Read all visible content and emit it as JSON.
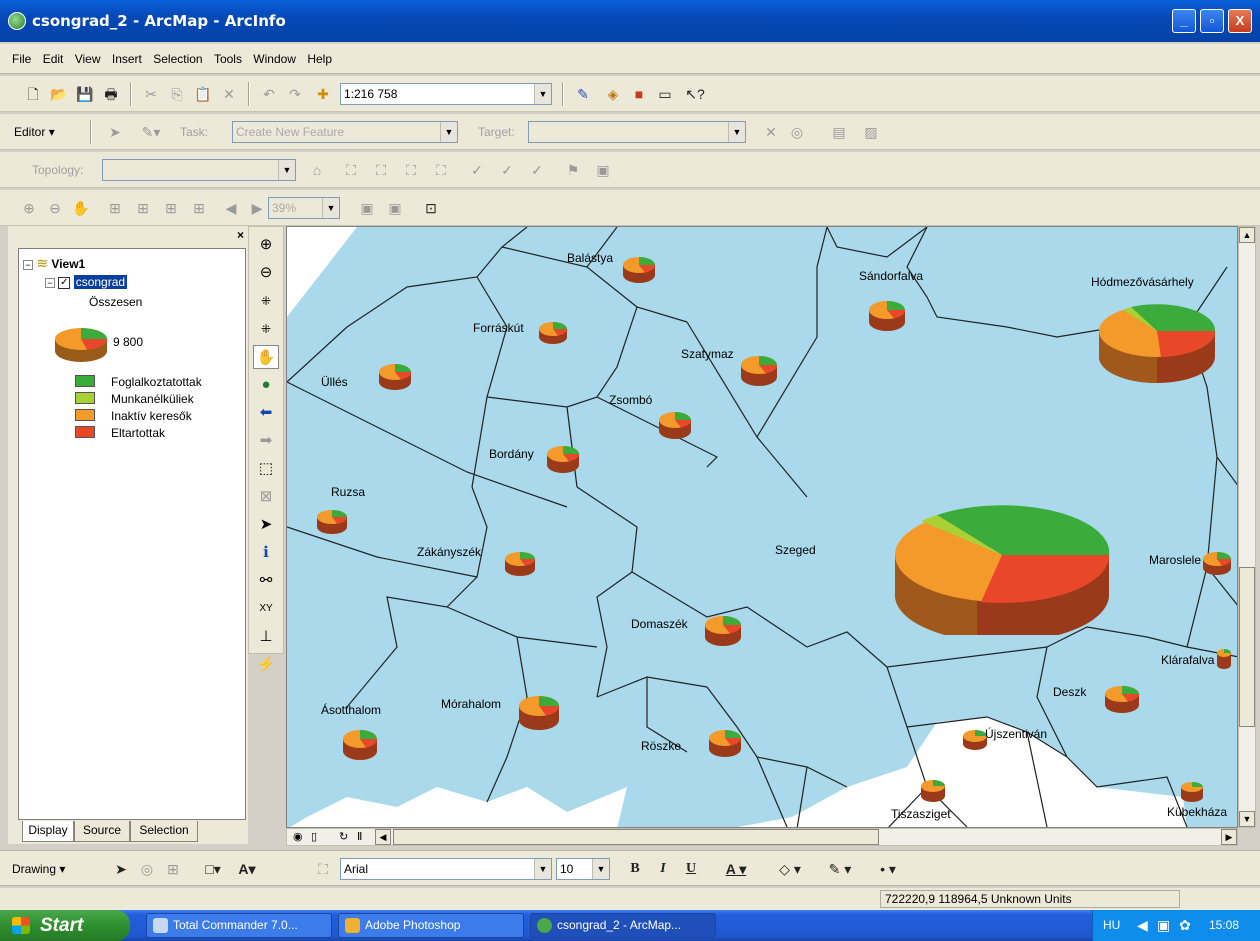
{
  "window": {
    "title": "csongrad_2 - ArcMap - ArcInfo",
    "min": "_",
    "max": "▫",
    "close": "X"
  },
  "menu": [
    "File",
    "Edit",
    "View",
    "Insert",
    "Selection",
    "Tools",
    "Window",
    "Help"
  ],
  "standard_toolbar": {
    "scale": "1:216 758"
  },
  "editor_toolbar": {
    "editor_label": "Editor",
    "task_label": "Task:",
    "task_value": "Create New Feature",
    "target_label": "Target:",
    "target_value": ""
  },
  "topology_toolbar": {
    "label": "Topology:",
    "value": ""
  },
  "layout_toolbar": {
    "zoom_value": "39%"
  },
  "toc": {
    "data_frame": "View1",
    "layer": "csongrad",
    "field": "Összesen",
    "size_value": "9 800",
    "legend": [
      {
        "label": "Foglalkoztatottak",
        "color": "#3bab3b"
      },
      {
        "label": "Munkanélküliek",
        "color": "#a8d135"
      },
      {
        "label": "Inaktív keresők",
        "color": "#f39a2a"
      },
      {
        "label": "Eltartottak",
        "color": "#e8472a"
      }
    ],
    "tabs": [
      "Display",
      "Source",
      "Selection"
    ]
  },
  "map": {
    "places": [
      "Balástya",
      "Sándorfalva",
      "Hódmezővásárhely",
      "Forráskút",
      "Szatymaz",
      "Üllés",
      "Zsombó",
      "Bordány",
      "Ruzsa",
      "Zákányszék",
      "Szeged",
      "Maroslele",
      "Domaszék",
      "Klárafalva",
      "Deszk",
      "Ásotthalom",
      "Mórahalom",
      "Röszke",
      "Újszentiván",
      "Tiszasziget",
      "Kübekháza"
    ]
  },
  "drawing_toolbar": {
    "label": "Drawing",
    "font": "Arial",
    "font_size": "10",
    "bold": "B",
    "italic": "I",
    "underline": "U"
  },
  "status": {
    "coords": "722220,9  118964,5 Unknown Units"
  },
  "taskbar": {
    "start": "Start",
    "tasks": [
      "Total Commander 7.0...",
      "Adobe Photoshop",
      "csongrad_2 - ArcMap..."
    ],
    "lang": "HU",
    "time": "15:08"
  }
}
